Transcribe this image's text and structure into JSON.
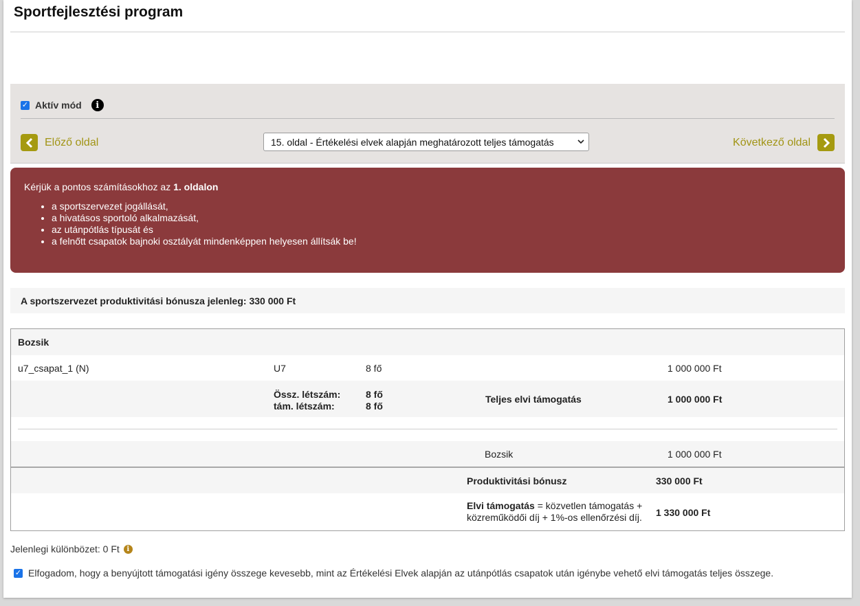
{
  "page": {
    "title": "Sportfejlesztési program"
  },
  "controls": {
    "active_mode_label": "Aktív mód",
    "active_mode_checked": true,
    "prev_label": "Előző oldal",
    "next_label": "Következő oldal",
    "page_select_value": "15. oldal - Értékelési elvek alapján meghatározott teljes támogatás"
  },
  "alert": {
    "intro_prefix": "Kérjük a pontos számításokhoz az ",
    "intro_bold": "1. oldalon",
    "items": [
      "a sportszervezet jogállását,",
      "a hivatásos sportoló alkalmazását,",
      "az utánpótlás típusát és",
      "a felnőtt csapatok bajnoki osztályát mindenképpen helyesen állítsák be!"
    ]
  },
  "bonus": {
    "text": "A sportszervezet produktivitási bónusza jelenleg: 330 000 Ft"
  },
  "grid": {
    "header": "Bozsik",
    "team": {
      "name": "u7_csapat_1 (N)",
      "age": "U7",
      "count": "8 fő",
      "amount": "1 000 000 Ft"
    },
    "totals": {
      "ossz_label": "Össz. létszám:",
      "tam_label": "tám. létszám:",
      "ossz_value": "8 fő",
      "tam_value": "8 fő",
      "support_label": "Teljes elvi támogatás",
      "support_value": "1 000 000 Ft"
    },
    "summary": {
      "label": "Bozsik",
      "value": "1 000 000 Ft"
    },
    "productivity": {
      "label": "Produktivitási bónusz",
      "value": "330 000 Ft"
    },
    "elvi": {
      "bold": "Elvi támogatás",
      "rest": " = közvetlen támogatás + közreműködői díj + 1%-os ellenőrzési díj.",
      "value": "1 330 000 Ft"
    }
  },
  "difference": {
    "text": "Jelenlegi különbözet: 0 Ft"
  },
  "acceptance": {
    "checked": true,
    "text": "Elfogadom, hogy a benyújtott támogatási igény összege kevesebb, mint az Értékelési Elvek alapján az utánpótlás csapatok után igénybe vehető elvi támogatás teljes összege."
  },
  "colors": {
    "accent": "#a59a10",
    "alert_bg": "#8b3a3c",
    "checkbox": "#1a73e8",
    "warn": "#b5851a"
  }
}
